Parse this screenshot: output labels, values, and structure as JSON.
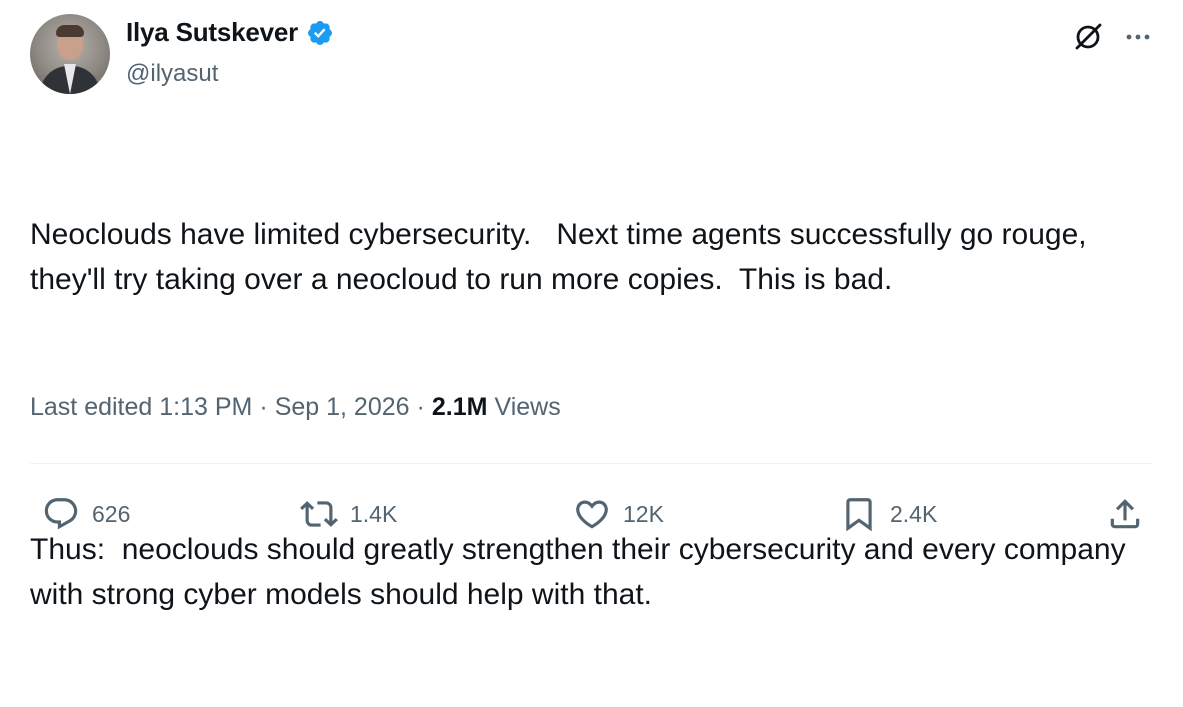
{
  "author": {
    "name": "Ilya Sutskever",
    "handle": "@ilyasut",
    "verified": true
  },
  "tweet": {
    "paragraphs": [
      "Neoclouds have limited cybersecurity.   Next time agents successfully go rouge, they'll try taking over a neocloud to run more copies.  This is bad.",
      "Thus:  neoclouds should greatly strengthen their cybersecurity and every company with strong cyber models should help with that."
    ]
  },
  "meta": {
    "edited_label": "Last edited 1:13 PM",
    "separator": "·",
    "date": "Sep 1, 2026",
    "views_count": "2.1M",
    "views_label": "Views"
  },
  "actions": {
    "replies": "626",
    "retweets": "1.4K",
    "likes": "12K",
    "bookmarks": "2.4K"
  },
  "colors": {
    "text": "#0f1419",
    "secondary": "#536471",
    "verified": "#1d9bf0",
    "divider": "#eff3f4"
  },
  "icons": [
    "verified-badge-icon",
    "grok-icon",
    "more-icon",
    "reply-icon",
    "retweet-icon",
    "like-icon",
    "bookmark-icon",
    "share-icon"
  ]
}
